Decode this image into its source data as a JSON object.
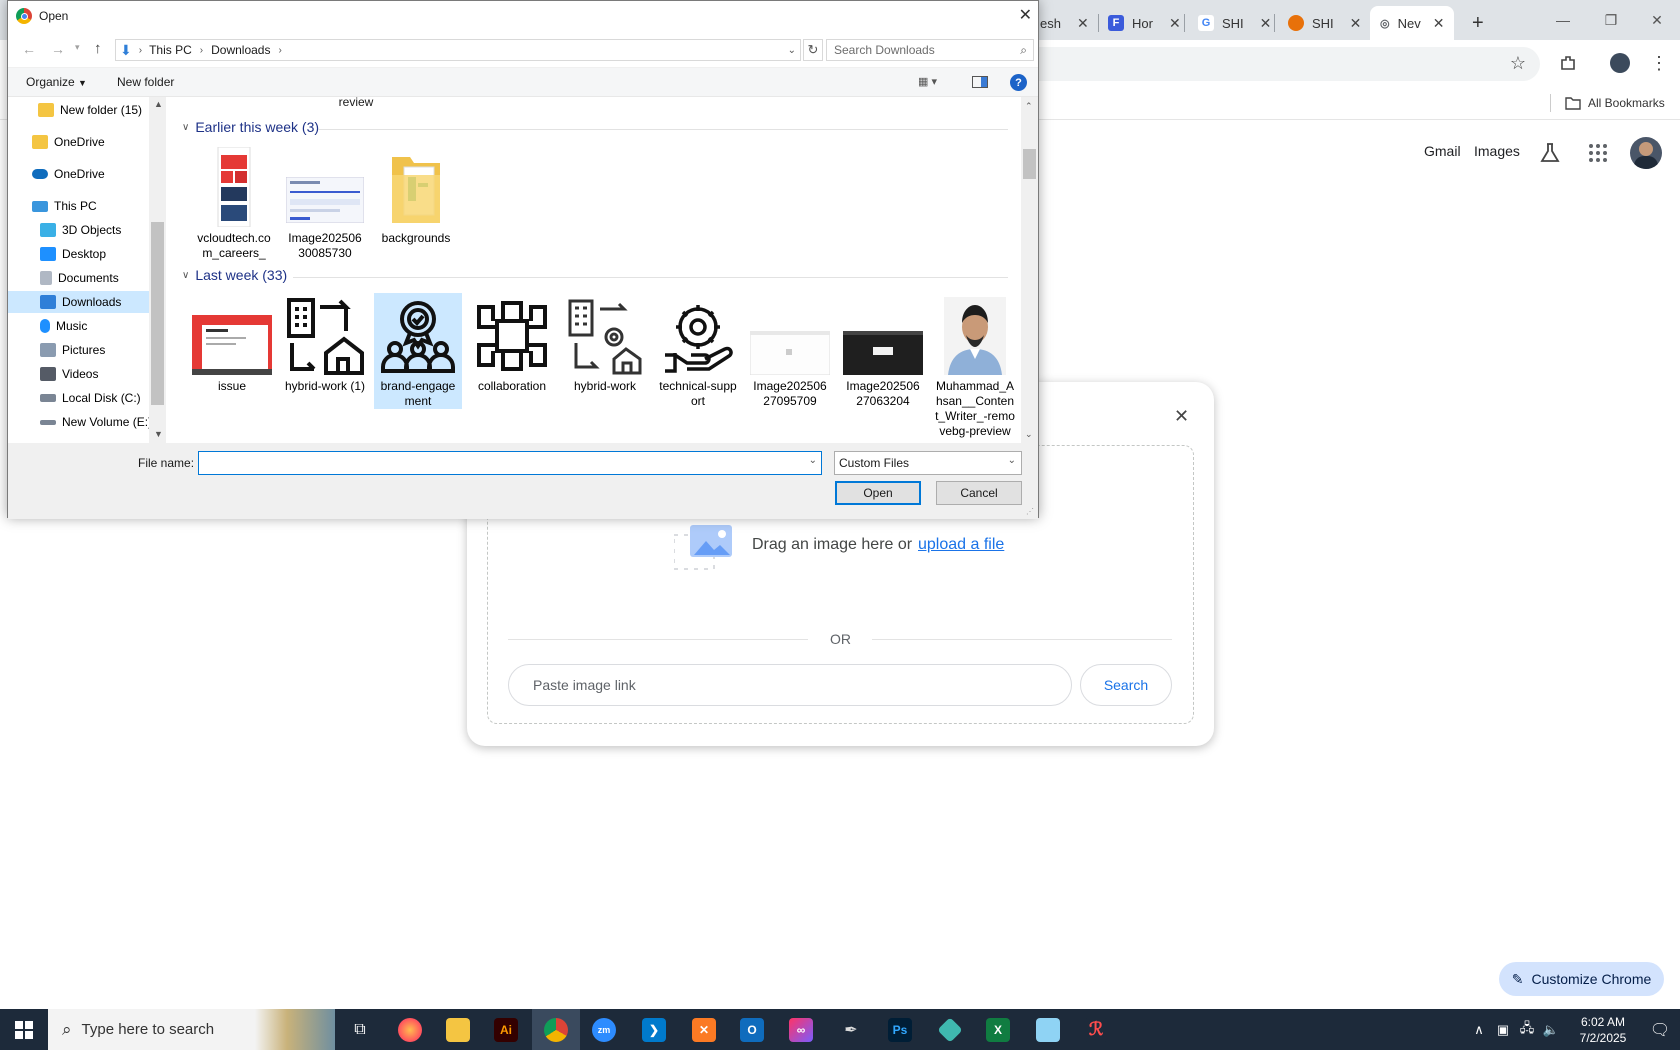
{
  "chrome": {
    "tabs": [
      {
        "label": "esh",
        "fav_color": "#ffffff",
        "fav_glyph": ""
      },
      {
        "label": "Hor",
        "fav_color": "#3b5bdb",
        "fav_glyph": "F"
      },
      {
        "label": "SHI",
        "fav_color": "#4285f4",
        "fav_glyph": "G"
      },
      {
        "label": "SHI",
        "fav_color": "#e8710a",
        "fav_glyph": "O"
      },
      {
        "label": "Nev",
        "fav_color": "#5f6368",
        "fav_glyph": "◎"
      }
    ],
    "new_tab_glyph": "+",
    "bookmarks_label": "All Bookmarks"
  },
  "google": {
    "gmail": "Gmail",
    "images": "Images"
  },
  "lens": {
    "drag_text": "Drag an image here or",
    "upload_link": "upload a file",
    "or_text": "OR",
    "paste_placeholder": "Paste image link",
    "search_button": "Search",
    "close_glyph": "✕"
  },
  "customize_chrome": "Customize Chrome",
  "dialog": {
    "title": "Open",
    "breadcrumb": [
      "This PC",
      "Downloads"
    ],
    "search_placeholder": "Search Downloads",
    "organize": "Organize",
    "new_folder": "New folder",
    "help_glyph": "?",
    "nav": [
      {
        "label": "New folder (15)",
        "icon": "folder-icon",
        "color": "#f4c542"
      },
      {
        "label": "OneDrive",
        "icon": "folder-icon",
        "color": "#f4c542"
      },
      {
        "label": "OneDrive",
        "icon": "cloud-icon",
        "color": "#0f6cbd"
      },
      {
        "label": "This PC",
        "icon": "computer-icon",
        "color": "#3a96dd"
      },
      {
        "label": "3D Objects",
        "icon": "cube-icon",
        "color": "#3ab0e6"
      },
      {
        "label": "Desktop",
        "icon": "desktop-icon",
        "color": "#1e90ff"
      },
      {
        "label": "Documents",
        "icon": "document-icon",
        "color": "#b0b8c4"
      },
      {
        "label": "Downloads",
        "icon": "download-icon",
        "color": "#2f7fd8"
      },
      {
        "label": "Music",
        "icon": "music-icon",
        "color": "#1e90ff"
      },
      {
        "label": "Pictures",
        "icon": "pictures-icon",
        "color": "#8a9bb0"
      },
      {
        "label": "Videos",
        "icon": "videos-icon",
        "color": "#555b66"
      },
      {
        "label": "Local Disk (C:)",
        "icon": "disk-icon",
        "color": "#7a8594"
      },
      {
        "label": "New Volume (E:)",
        "icon": "drive-icon",
        "color": "#7a8594"
      }
    ],
    "partial_top_label": "review",
    "groups": [
      {
        "heading": "Earlier this week (3)",
        "files": [
          {
            "name": "vcloudtech.com_careers_",
            "thumb": "doc-red"
          },
          {
            "name": "Image20250630085730",
            "thumb": "screenshot-light"
          },
          {
            "name": "backgrounds",
            "thumb": "folder"
          }
        ]
      },
      {
        "heading": "Last week (33)",
        "files": [
          {
            "name": "issue",
            "thumb": "slide-red"
          },
          {
            "name": "hybrid-work (1)",
            "thumb": "icon-building-home"
          },
          {
            "name": "brand-engagement",
            "thumb": "icon-badge-people"
          },
          {
            "name": "collaboration",
            "thumb": "icon-hands"
          },
          {
            "name": "hybrid-work",
            "thumb": "icon-building-gear"
          },
          {
            "name": "technical-support",
            "thumb": "icon-gear-hand"
          },
          {
            "name": "Image20250627095709",
            "thumb": "screenshot-white"
          },
          {
            "name": "Image20250627063204",
            "thumb": "screenshot-dark"
          },
          {
            "name": "Muhammad_Ahsan__Content_Writer_-removebg-preview",
            "thumb": "portrait"
          }
        ]
      }
    ],
    "filename_label": "File name:",
    "filename_value": "",
    "filetype": "Custom Files",
    "open_button": "Open",
    "cancel_button": "Cancel"
  },
  "taskbar": {
    "search_placeholder": "Type here to search",
    "time": "6:02 AM",
    "date": "7/2/2025"
  }
}
